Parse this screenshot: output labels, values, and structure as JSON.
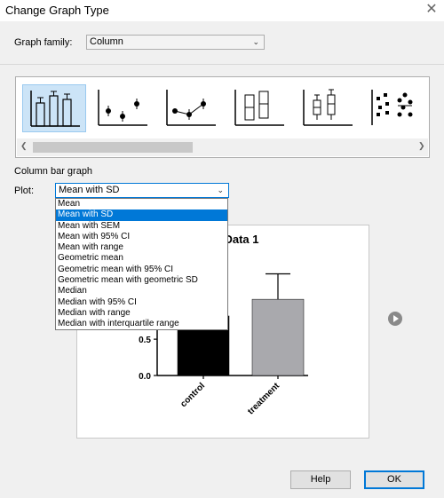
{
  "dialog": {
    "title": "Change Graph Type",
    "close_glyph": "✕"
  },
  "graph_family": {
    "label": "Graph family:",
    "value": "Column"
  },
  "gallery": {
    "thumbnails": [
      {
        "name": "column-bar-icon",
        "selected": true
      },
      {
        "name": "column-mean-points-icon",
        "selected": false
      },
      {
        "name": "column-mean-connected-icon",
        "selected": false
      },
      {
        "name": "column-floating-bar-icon",
        "selected": false
      },
      {
        "name": "column-box-plot-icon",
        "selected": false
      },
      {
        "name": "column-scatter-dots-icon",
        "selected": false
      }
    ]
  },
  "graph_type_name": "Column bar graph",
  "plot": {
    "label": "Plot:",
    "value": "Mean with SD",
    "options": [
      "Mean",
      "Mean with SD",
      "Mean with SEM",
      "Mean with 95% CI",
      "Mean with range",
      "Geometric mean",
      "Geometric mean with 95% CI",
      "Geometric mean with geometric SD",
      "Median",
      "Median with 95% CI",
      "Median with range",
      "Median with interquartile range"
    ],
    "selected_index": 1
  },
  "chart_data": {
    "type": "bar",
    "title": "Data 1",
    "categories": [
      "control",
      "treatment"
    ],
    "values": [
      0.82,
      1.05
    ],
    "errors": [
      null,
      0.35
    ],
    "ytick_labels": [
      "0.0",
      "0.5"
    ],
    "ylim": [
      0,
      1.7
    ],
    "colors": [
      "#000000",
      "#a9a9ad"
    ]
  },
  "buttons": {
    "help": "Help",
    "ok": "OK"
  }
}
